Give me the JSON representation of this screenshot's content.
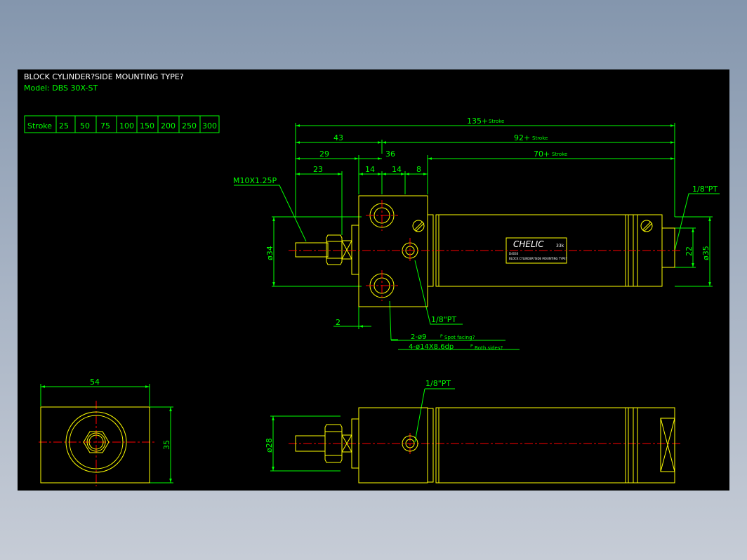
{
  "title": {
    "line1": "BLOCK CYLINDER?SIDE MOUNTING TYPE?",
    "line2": "Model: DBS 30X-ST"
  },
  "stroke_table": {
    "header": "Stroke",
    "values": [
      "25",
      "50",
      "75",
      "100",
      "150",
      "200",
      "250",
      "300"
    ]
  },
  "dimensions": {
    "overall": "135+",
    "overall_suffix": "Stroke",
    "d43": "43",
    "d92": "92+",
    "d92_suffix": "Stroke",
    "d29": "29",
    "d36": "36",
    "d70": "70+",
    "d70_suffix": "Stroke",
    "d23": "23",
    "d14a": "14",
    "d14b": "14",
    "d8": "8",
    "d2": "2",
    "dia34": "ø34",
    "d22": "22",
    "dia35": "ø35",
    "dia28": "ø28",
    "d54": "54",
    "d35": "35"
  },
  "callouts": {
    "thread": "M10X1.25P",
    "port_top_right": "1/8\"PT",
    "port_center": "1/8\"PT",
    "spot_facing_a": "2-ø9",
    "spot_facing_b": "P",
    "spot_facing_c": "Spot facing?",
    "through_hole_a": "4-ø14X8.6dp",
    "through_hole_b": "P",
    "through_hole_c": "Both sides?",
    "port_bottom_view": "1/8\"PT"
  },
  "label_plate": {
    "brand": "CHELIC",
    "sub": "33k",
    "line1": "D4030",
    "line2": "BLOCK CYLINDER?SIDE MOUNTING TYPE?"
  },
  "colors": {
    "background": "#000000",
    "outline": "#ffff00",
    "dimension": "#00ff00",
    "centerline": "#ff0000",
    "text": "#ffffff"
  }
}
